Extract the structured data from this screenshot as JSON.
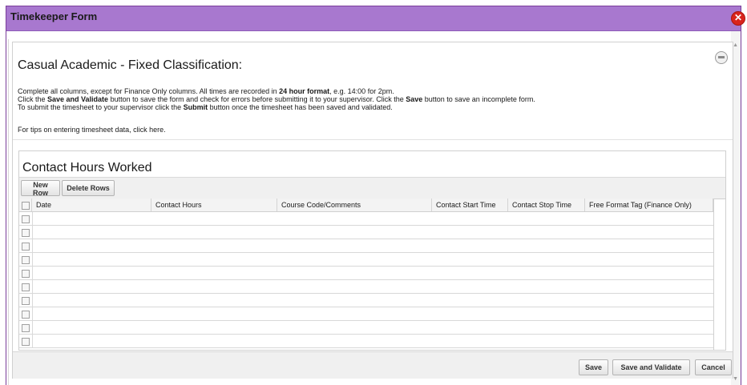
{
  "window": {
    "title": "Timekeeper Form",
    "close_icon": "close-icon",
    "accent_color": "#a878cf"
  },
  "form": {
    "heading": "Casual Academic - Fixed Classification:",
    "instructions": [
      {
        "text": "Complete all columns, except for Finance Only columns. All times are recorded in "
      },
      {
        "text": "24 hour format",
        "bold": true
      },
      {
        "text": ", e.g. 14:00 for 2pm."
      },
      {
        "br": true
      },
      {
        "text": "Click the "
      },
      {
        "text": "Save and Validate",
        "bold": true
      },
      {
        "text": " button to save the form and check for errors before submitting it to your supervisor. Click the "
      },
      {
        "text": "Save",
        "bold": true
      },
      {
        "text": " button to save an incomplete form."
      },
      {
        "br": true
      },
      {
        "text": "To submit the timesheet to your supervisor click the "
      },
      {
        "text": "Submit",
        "bold": true
      },
      {
        "text": " button once the timesheet has been saved and validated."
      }
    ],
    "tip_text": "For tips on entering timesheet data, click here."
  },
  "grid": {
    "title": "Contact Hours Worked",
    "toolbar": {
      "new_row": "New Row",
      "delete_rows": "Delete Rows"
    },
    "columns": [
      {
        "label": "Date"
      },
      {
        "label": "Contact Hours"
      },
      {
        "label": "Course Code/Comments"
      },
      {
        "label": "Contact Start Time"
      },
      {
        "label": "Contact Stop Time"
      },
      {
        "label": "Free Format Tag (Finance Only)"
      }
    ],
    "row_count": 10
  },
  "footer": {
    "save": "Save",
    "save_validate": "Save and Validate",
    "cancel": "Cancel"
  }
}
